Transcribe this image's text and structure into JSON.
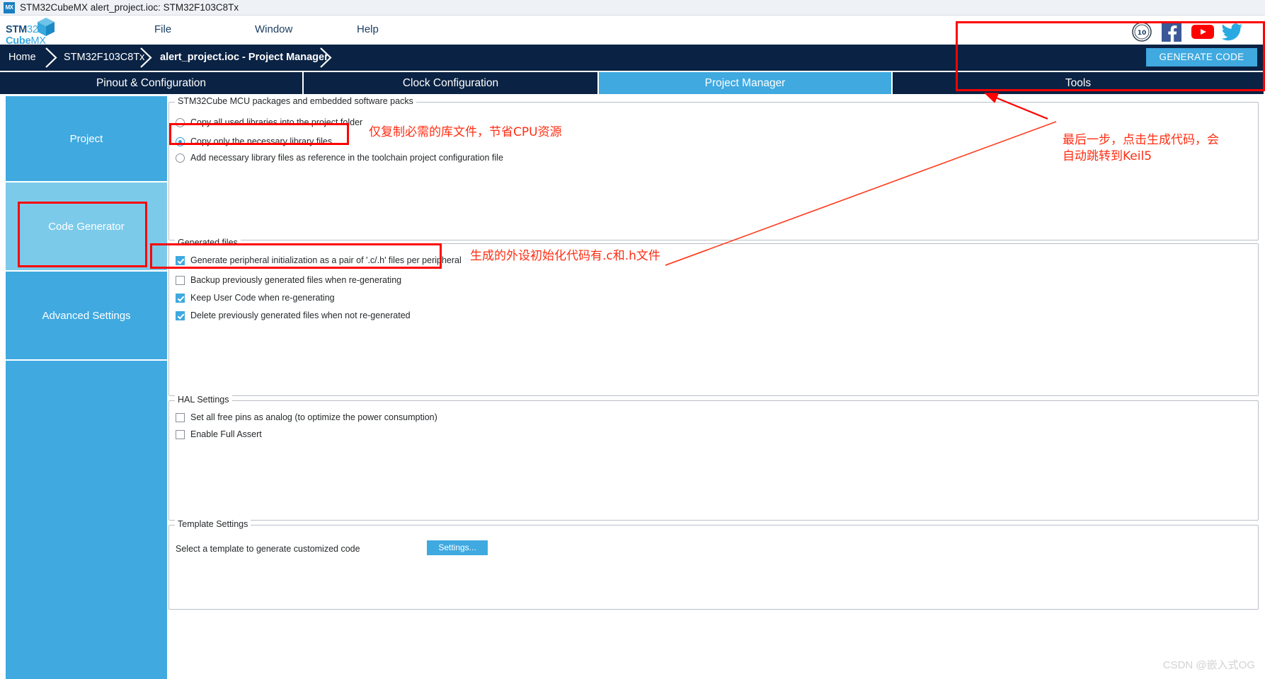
{
  "window": {
    "title": "STM32CubeMX alert_project.ioc: STM32F103C8Tx",
    "icon": "MX"
  },
  "menu": {
    "logo_top": "STM32",
    "logo_bottom": "CubeMX",
    "items": [
      {
        "label": "File",
        "name": "menu-file"
      },
      {
        "label": "Window",
        "name": "menu-window"
      },
      {
        "label": "Help",
        "name": "menu-help"
      }
    ],
    "social": [
      {
        "name": "ten-years-badge-icon",
        "label": "10"
      },
      {
        "name": "facebook-icon",
        "label": "f"
      },
      {
        "name": "youtube-icon",
        "label": "YouTube"
      },
      {
        "name": "twitter-icon",
        "label": "Twitter"
      }
    ]
  },
  "breadcrumb": {
    "items": [
      {
        "label": "Home",
        "bold": false
      },
      {
        "label": "STM32F103C8Tx",
        "bold": false
      },
      {
        "label": "alert_project.ioc - Project Manager",
        "bold": true
      }
    ],
    "generate_code_label": "GENERATE CODE"
  },
  "tabs": [
    {
      "label": "Pinout & Configuration",
      "active": false
    },
    {
      "label": "Clock Configuration",
      "active": false
    },
    {
      "label": "Project Manager",
      "active": true
    },
    {
      "label": "Tools",
      "active": false
    }
  ],
  "sidebar": {
    "items": [
      {
        "label": "Project",
        "selected": false
      },
      {
        "label": "Code Generator",
        "selected": true
      },
      {
        "label": "Advanced Settings",
        "selected": false
      }
    ]
  },
  "main": {
    "mcu_packages": {
      "title": "STM32Cube MCU packages and embedded software packs",
      "options": [
        {
          "label": "Copy all used libraries into the project folder",
          "checked": false
        },
        {
          "label": "Copy only the necessary library files",
          "checked": true
        },
        {
          "label": "Add necessary library files as reference in the toolchain project configuration file",
          "checked": false
        }
      ]
    },
    "generated_files": {
      "title": "Generated files",
      "options": [
        {
          "label": "Generate peripheral initialization as a pair of '.c/.h' files per peripheral",
          "checked": true
        },
        {
          "label": "Backup previously generated files when re-generating",
          "checked": false
        },
        {
          "label": "Keep User Code when re-generating",
          "checked": true
        },
        {
          "label": "Delete previously generated files when not re-generated",
          "checked": true
        }
      ]
    },
    "hal_settings": {
      "title": "HAL Settings",
      "options": [
        {
          "label": "Set all free pins as analog (to optimize the power consumption)",
          "checked": false
        },
        {
          "label": "Enable Full Assert",
          "checked": false
        }
      ]
    },
    "template_settings": {
      "title": "Template Settings",
      "description": "Select a template to generate customized code",
      "button_label": "Settings..."
    }
  },
  "annotations": [
    {
      "name": "annotation-copy-only-library",
      "text": "仅复制必需的库文件，节省CPU资源"
    },
    {
      "name": "annotation-generated-files",
      "text": "生成的外设初始化代码有.c和.h文件"
    },
    {
      "name": "annotation-generate-code",
      "text": "最后一步，点击生成代码，会\n自动跳转到Keil5"
    }
  ],
  "watermark": "CSDN @嵌入式OG",
  "colors": {
    "accent": "#3fa9e0",
    "navy": "#0a2243",
    "annotation_red": "#ff2d12",
    "sidebar_selected": "#7ccaea"
  }
}
